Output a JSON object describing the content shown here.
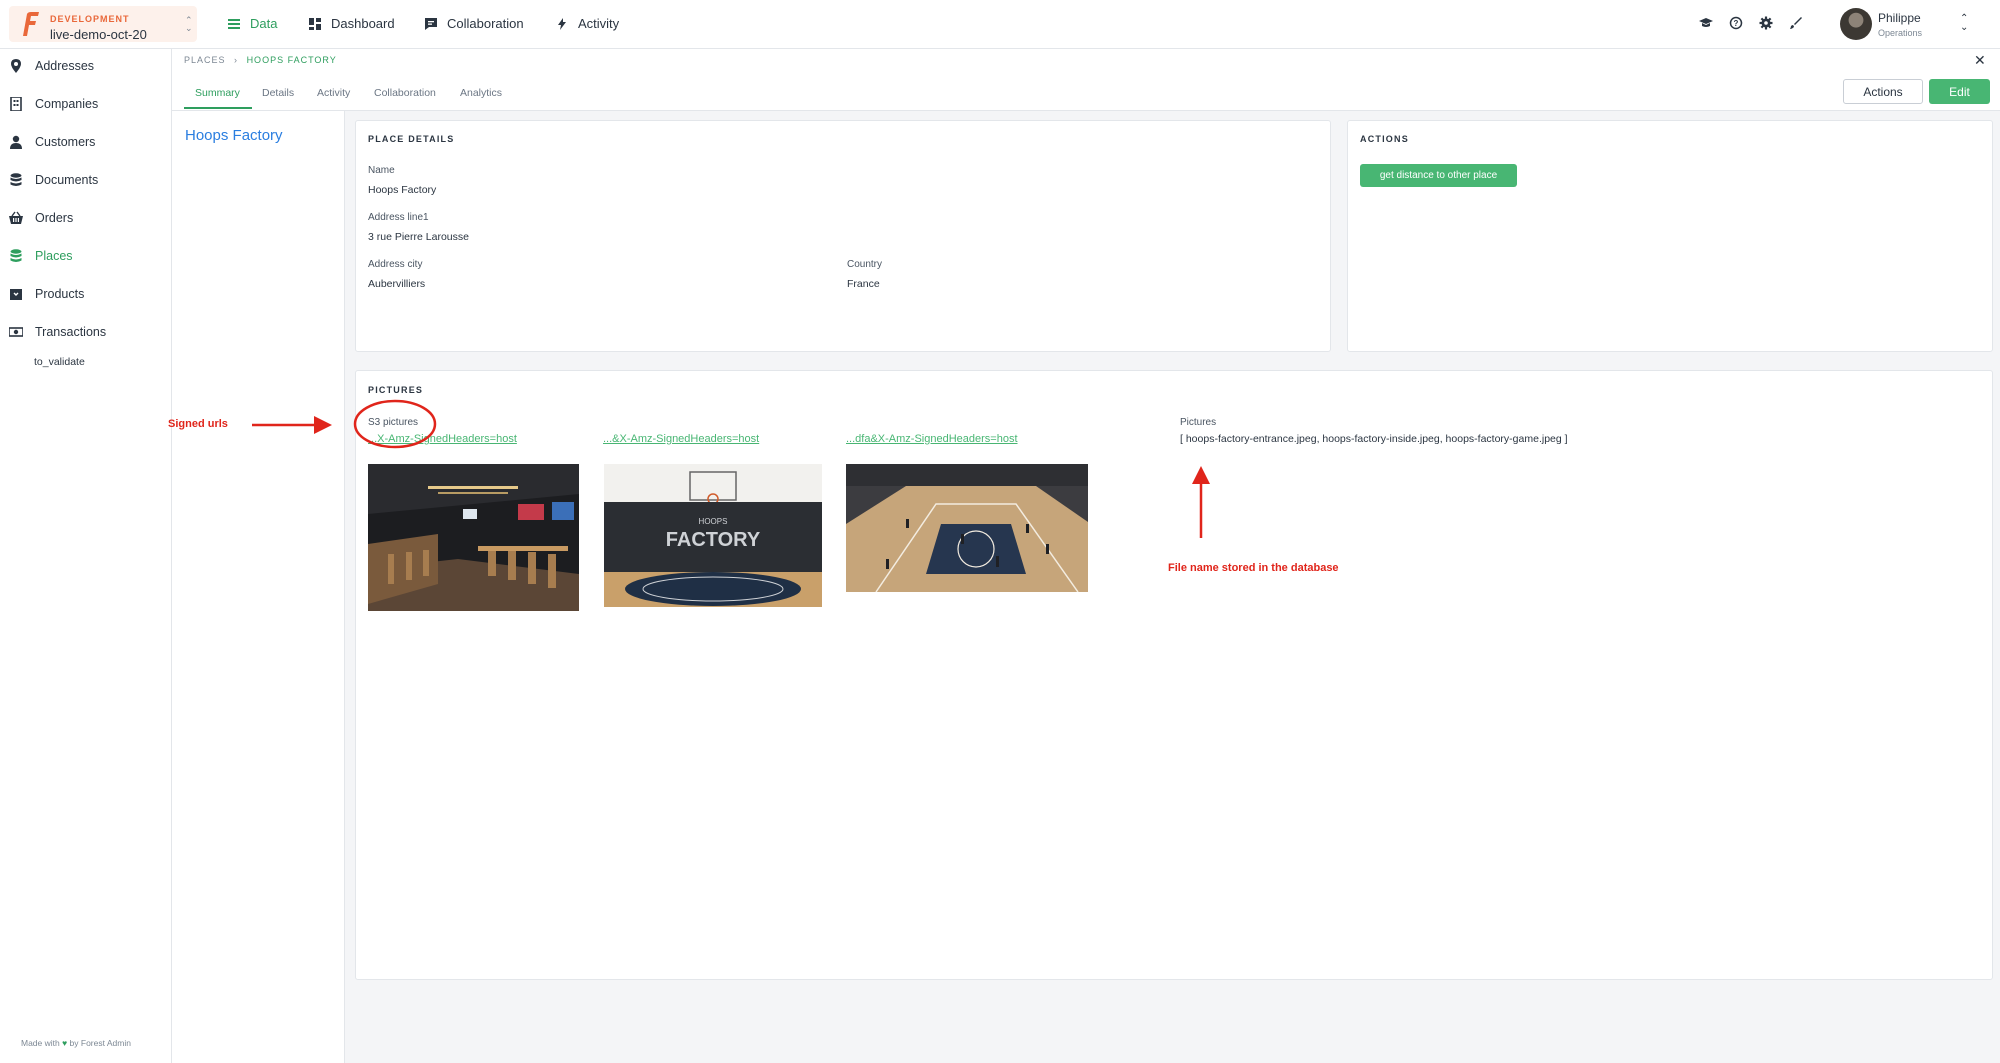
{
  "environment": {
    "tag": "DEVELOPMENT",
    "name": "live-demo-oct-20"
  },
  "nav": {
    "tabs": [
      {
        "label": "Data",
        "icon": "list-icon"
      },
      {
        "label": "Dashboard",
        "icon": "dashboard-icon"
      },
      {
        "label": "Collaboration",
        "icon": "chat-icon"
      },
      {
        "label": "Activity",
        "icon": "bolt-icon"
      }
    ]
  },
  "user": {
    "name": "Philippe",
    "role": "Operations"
  },
  "sidebar": {
    "items": [
      {
        "label": "Addresses",
        "icon": "map-pin-icon"
      },
      {
        "label": "Companies",
        "icon": "building-icon"
      },
      {
        "label": "Customers",
        "icon": "person-icon"
      },
      {
        "label": "Documents",
        "icon": "database-icon"
      },
      {
        "label": "Orders",
        "icon": "basket-icon"
      },
      {
        "label": "Places",
        "icon": "database-icon"
      },
      {
        "label": "Products",
        "icon": "box-icon"
      },
      {
        "label": "Transactions",
        "icon": "money-icon"
      }
    ],
    "sub_item": "to_validate",
    "footer_prefix": "Made with",
    "footer_suffix": "by Forest Admin"
  },
  "breadcrumb": {
    "root": "PLACES",
    "separator": "›",
    "current": "HOOPS FACTORY"
  },
  "record_tabs": [
    "Summary",
    "Details",
    "Activity",
    "Collaboration",
    "Analytics"
  ],
  "header_buttons": {
    "actions": "Actions",
    "edit": "Edit"
  },
  "record": {
    "title": "Hoops Factory"
  },
  "place_details": {
    "title": "PLACE DETAILS",
    "fields": {
      "name_label": "Name",
      "name_value": "Hoops Factory",
      "address_label": "Address line1",
      "address_value": "3 rue Pierre Larousse",
      "city_label": "Address city",
      "city_value": "Aubervilliers",
      "country_label": "Country",
      "country_value": "France"
    }
  },
  "actions_card": {
    "title": "ACTIONS",
    "button": "get distance to other place"
  },
  "pictures": {
    "title": "PICTURES",
    "s3_label": "S3 pictures",
    "links": [
      "...X-Amz-SignedHeaders=host",
      "...&X-Amz-SignedHeaders=host",
      "...dfa&X-Amz-SignedHeaders=host"
    ],
    "db_label": "Pictures",
    "db_value": "[ hoops-factory-entrance.jpeg, hoops-factory-inside.jpeg, hoops-factory-game.jpeg ]",
    "court_text": "FACTORY",
    "court_text_small": "HOOPS"
  },
  "annotations": {
    "signed_urls": "Signed urls",
    "file_name": "File name stored in the database",
    "color": "#e0251b"
  },
  "colors": {
    "accent": "#2e9e5e",
    "button": "#48b673",
    "link": "#2a7ee0",
    "brand": "#e9683a"
  }
}
